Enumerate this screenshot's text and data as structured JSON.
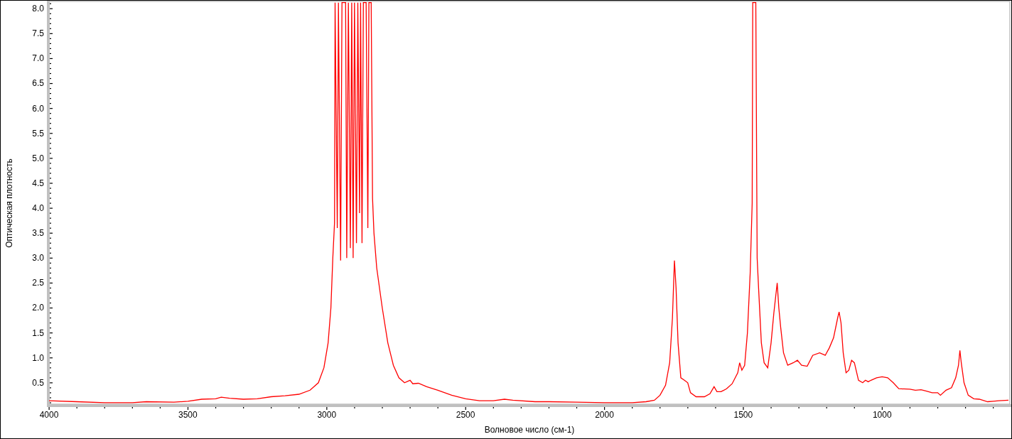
{
  "chart_data": {
    "type": "line",
    "xlabel": "Волновое число (см-1)",
    "ylabel": "Оптическая плотность",
    "xlim": [
      4000,
      540
    ],
    "ylim": [
      0.07,
      8.13
    ],
    "xticks": [
      4000,
      3500,
      3000,
      2500,
      2000,
      1500,
      1000
    ],
    "yticks": [
      {
        "value": 0.5,
        "label": "0.5"
      },
      {
        "value": 1,
        "label": "1.0"
      },
      {
        "value": 1.5,
        "label": "1.5"
      },
      {
        "value": 2,
        "label": "2.0"
      },
      {
        "value": 2.5,
        "label": "2.5"
      },
      {
        "value": 3,
        "label": "3.0"
      },
      {
        "value": 3.5,
        "label": "3.5"
      },
      {
        "value": 4,
        "label": "4.0"
      },
      {
        "value": 4.5,
        "label": "4.5"
      },
      {
        "value": 5,
        "label": "5.0"
      },
      {
        "value": 5.5,
        "label": "5.5"
      },
      {
        "value": 6,
        "label": "6.0"
      },
      {
        "value": 6.5,
        "label": "6.5"
      },
      {
        "value": 7,
        "label": "7.0"
      },
      {
        "value": 7.5,
        "label": "7.5"
      },
      {
        "value": 8,
        "label": "8.0"
      }
    ],
    "x": [
      4000,
      3900,
      3800,
      3700,
      3650,
      3550,
      3500,
      3450,
      3400,
      3380,
      3350,
      3300,
      3250,
      3200,
      3150,
      3100,
      3060,
      3030,
      3010,
      2995,
      2985,
      2978,
      2972,
      2970,
      2962,
      2958,
      2950,
      2945,
      2932,
      2928,
      2922,
      2915,
      2910,
      2905,
      2900,
      2893,
      2888,
      2882,
      2878,
      2873,
      2868,
      2858,
      2852,
      2848,
      2840,
      2835,
      2830,
      2820,
      2800,
      2780,
      2760,
      2740,
      2720,
      2700,
      2690,
      2670,
      2640,
      2600,
      2550,
      2500,
      2450,
      2400,
      2360,
      2330,
      2250,
      2200,
      2100,
      2000,
      1900,
      1850,
      1820,
      1800,
      1780,
      1765,
      1755,
      1748,
      1742,
      1735,
      1725,
      1712,
      1700,
      1690,
      1670,
      1640,
      1620,
      1605,
      1595,
      1580,
      1560,
      1540,
      1520,
      1513,
      1505,
      1495,
      1485,
      1475,
      1468,
      1466,
      1455,
      1450,
      1445,
      1435,
      1425,
      1412,
      1400,
      1390,
      1378,
      1372,
      1365,
      1355,
      1340,
      1320,
      1305,
      1290,
      1270,
      1250,
      1225,
      1205,
      1190,
      1175,
      1160,
      1155,
      1148,
      1140,
      1130,
      1120,
      1110,
      1100,
      1085,
      1070,
      1060,
      1050,
      1040,
      1020,
      1000,
      980,
      960,
      940,
      900,
      880,
      860,
      840,
      820,
      800,
      790,
      770,
      750,
      735,
      725,
      720,
      715,
      705,
      690,
      670,
      650,
      620,
      600,
      580,
      545
    ],
    "series": [
      {
        "color": "#ff0000",
        "values": [
          0.14,
          0.12,
          0.1,
          0.1,
          0.12,
          0.11,
          0.13,
          0.17,
          0.18,
          0.21,
          0.19,
          0.17,
          0.18,
          0.22,
          0.24,
          0.27,
          0.35,
          0.5,
          0.8,
          1.3,
          2.0,
          3.0,
          3.7,
          8.12,
          3.6,
          8.12,
          2.95,
          8.12,
          8.12,
          3.0,
          8.12,
          3.2,
          8.12,
          3.0,
          8.12,
          3.3,
          8.12,
          3.9,
          8.12,
          3.3,
          8.12,
          8.12,
          3.6,
          8.12,
          8.12,
          4.2,
          3.5,
          2.8,
          2.0,
          1.3,
          0.85,
          0.6,
          0.5,
          0.55,
          0.48,
          0.49,
          0.42,
          0.35,
          0.25,
          0.18,
          0.14,
          0.14,
          0.17,
          0.15,
          0.12,
          0.12,
          0.11,
          0.1,
          0.1,
          0.12,
          0.15,
          0.25,
          0.45,
          0.9,
          1.8,
          2.95,
          2.4,
          1.3,
          0.6,
          0.55,
          0.5,
          0.3,
          0.22,
          0.22,
          0.28,
          0.42,
          0.32,
          0.32,
          0.38,
          0.48,
          0.7,
          0.9,
          0.75,
          0.85,
          1.5,
          2.7,
          4.1,
          8.12,
          8.12,
          3.0,
          2.4,
          1.3,
          0.9,
          0.8,
          1.3,
          1.9,
          2.5,
          2.0,
          1.6,
          1.1,
          0.85,
          0.9,
          0.95,
          0.85,
          0.83,
          1.05,
          1.1,
          1.05,
          1.2,
          1.4,
          1.8,
          1.92,
          1.7,
          1.1,
          0.7,
          0.75,
          0.95,
          0.9,
          0.55,
          0.5,
          0.55,
          0.52,
          0.55,
          0.6,
          0.62,
          0.6,
          0.5,
          0.38,
          0.37,
          0.35,
          0.36,
          0.33,
          0.3,
          0.3,
          0.25,
          0.35,
          0.4,
          0.6,
          0.85,
          1.15,
          0.9,
          0.5,
          0.25,
          0.18,
          0.17,
          0.12,
          0.13,
          0.14,
          0.15
        ]
      }
    ]
  }
}
